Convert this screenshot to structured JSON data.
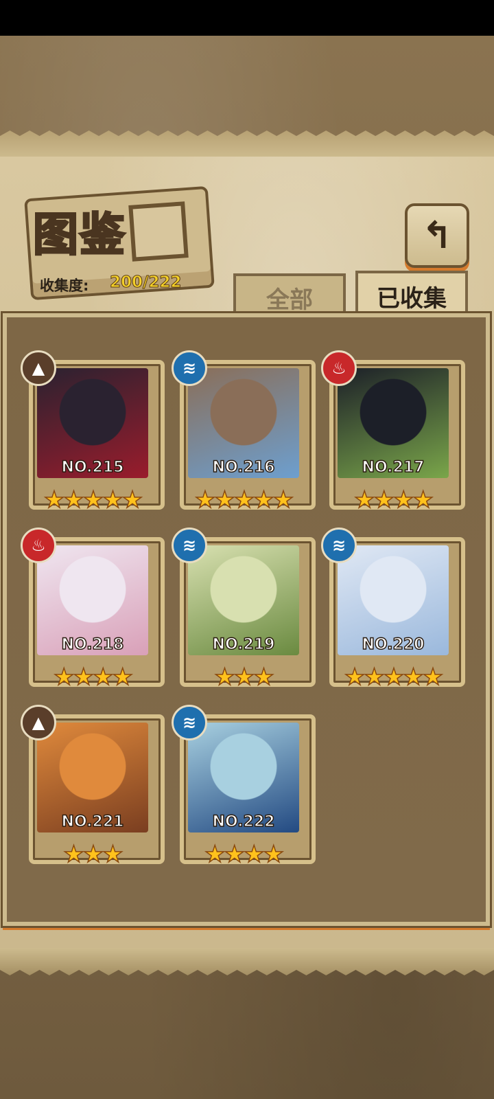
{
  "header": {
    "title": "图鉴",
    "collection_label": "收集度:",
    "collection_value": "200/222",
    "back_icon": "back-arrow-icon"
  },
  "tabs": [
    {
      "label": "全部",
      "selected": false
    },
    {
      "label": "已收集",
      "selected": true
    }
  ],
  "colors": {
    "earth": "#5a3e2a",
    "water": "#1f6fae",
    "fire": "#c8282a",
    "star": "#ffc21c",
    "accent_orange": "#d57a2c"
  },
  "cards": [
    {
      "no": "NO.215",
      "element": "earth",
      "element_icon": "mountain-icon",
      "stars": 5,
      "star_text": "★★★★★",
      "portrait": [
        "#2a2230",
        "#9a1c2c"
      ]
    },
    {
      "no": "NO.216",
      "element": "water",
      "element_icon": "water-waves-icon",
      "stars": 5,
      "star_text": "★★★★★",
      "portrait": [
        "#8a6e58",
        "#6d9fcf"
      ]
    },
    {
      "no": "NO.217",
      "element": "fire",
      "element_icon": "flame-icon",
      "stars": 4,
      "star_text": "★★★★",
      "portrait": [
        "#1c1f28",
        "#7aa64a"
      ]
    },
    {
      "no": "NO.218",
      "element": "fire",
      "element_icon": "flame-icon",
      "stars": 4,
      "star_text": "★★★★",
      "portrait": [
        "#efe6f0",
        "#d9a0b8"
      ]
    },
    {
      "no": "NO.219",
      "element": "water",
      "element_icon": "water-waves-icon",
      "stars": 3,
      "star_text": "★★★",
      "portrait": [
        "#d8e0b0",
        "#6a8a40"
      ]
    },
    {
      "no": "NO.220",
      "element": "water",
      "element_icon": "water-waves-icon",
      "stars": 5,
      "star_text": "★★★★★",
      "portrait": [
        "#e0e8f4",
        "#9ab8dc"
      ]
    },
    {
      "no": "NO.221",
      "element": "earth",
      "element_icon": "mountain-icon",
      "stars": 3,
      "star_text": "★★★",
      "portrait": [
        "#e08a3c",
        "#7a3e20"
      ]
    },
    {
      "no": "NO.222",
      "element": "water",
      "element_icon": "water-waves-icon",
      "stars": 4,
      "star_text": "★★★★",
      "portrait": [
        "#a8d0e0",
        "#234a82"
      ]
    }
  ]
}
